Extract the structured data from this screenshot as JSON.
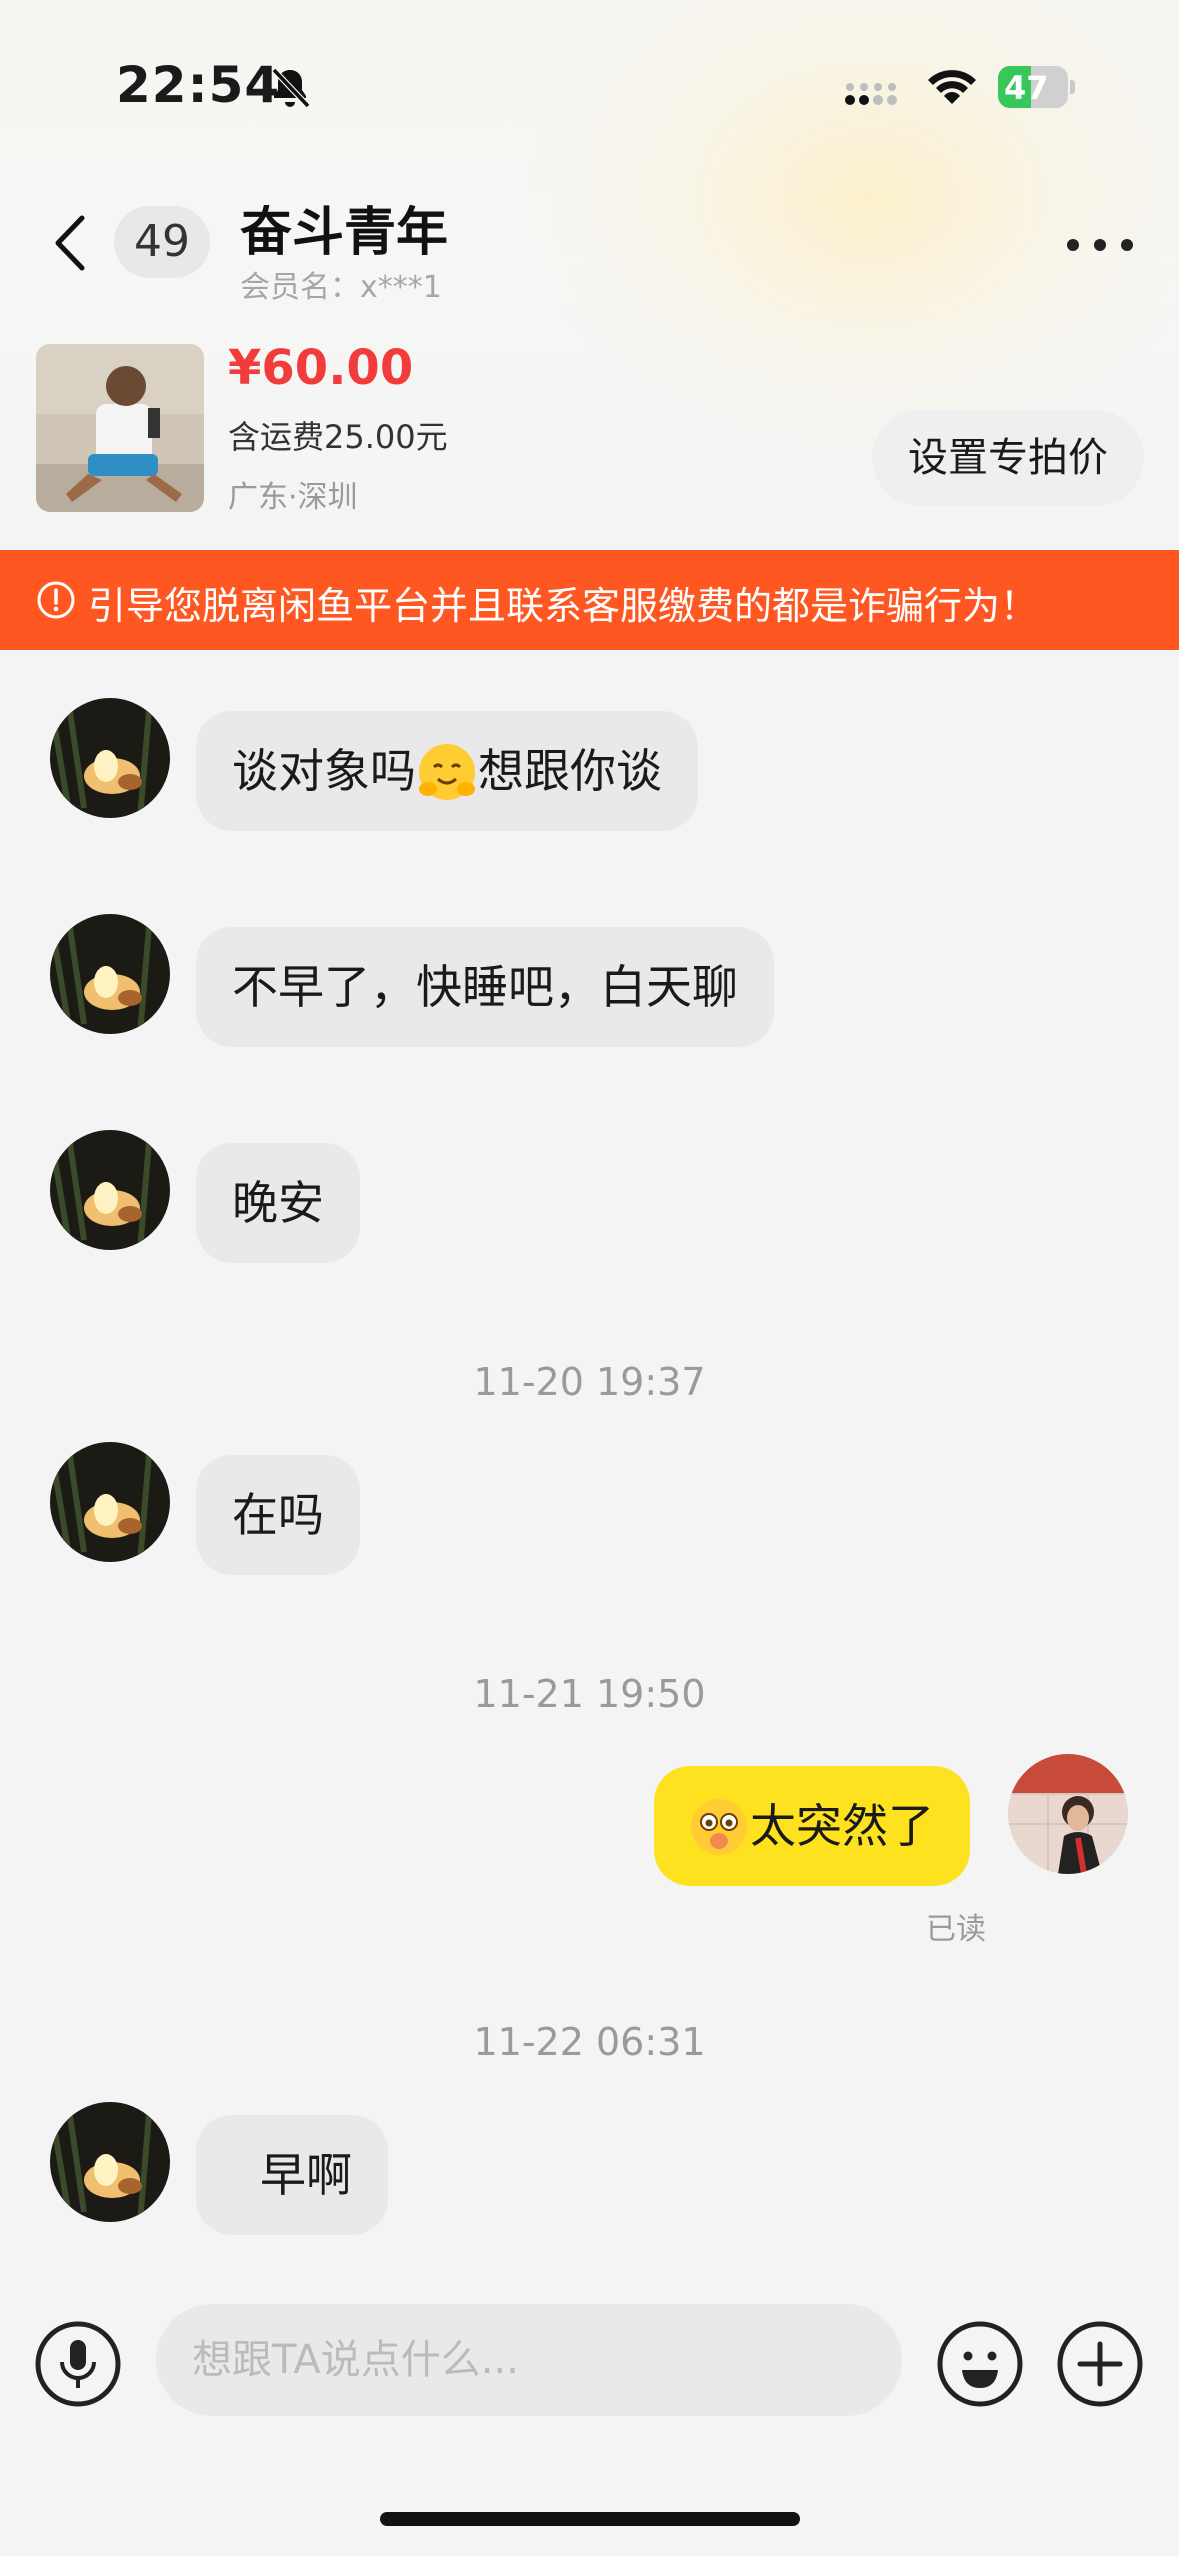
{
  "status_bar": {
    "time": "22:54",
    "battery": "47",
    "battery_level": 0.47
  },
  "header": {
    "unread_count": "49",
    "title": "奋斗青年",
    "member_name": "会员名：x***1"
  },
  "product": {
    "price": "¥60.00",
    "shipping": "含运费25.00元",
    "location": "广东·深圳",
    "special_price_button": "设置专拍价"
  },
  "warning": {
    "text": "引导您脱离闲鱼平台并且联系客服缴费的都是诈骗行为！",
    "color": "#ff5722"
  },
  "messages": [
    {
      "from": "other",
      "before_emoji": "谈对象吗",
      "after_emoji": "想跟你谈",
      "emoji": "hugging-face"
    },
    {
      "from": "other",
      "text": "不早了，快睡吧，白天聊"
    },
    {
      "from": "other",
      "text": "晚安"
    },
    {
      "type": "timestamp",
      "text": "11-20 19:37"
    },
    {
      "from": "other",
      "text": "在吗"
    },
    {
      "type": "timestamp",
      "text": "11-21 19:50"
    },
    {
      "from": "me",
      "text": "太突然了",
      "emoji": "surprised-face",
      "read_status": "已读"
    },
    {
      "type": "timestamp",
      "text": "11-22 06:31"
    },
    {
      "from": "other",
      "text": "早啊"
    }
  ],
  "input": {
    "placeholder": "想跟TA说点什么..."
  },
  "colors": {
    "price": "#f23c3c",
    "my_bubble": "#ffe21f",
    "other_bubble": "#e9e9eb"
  }
}
